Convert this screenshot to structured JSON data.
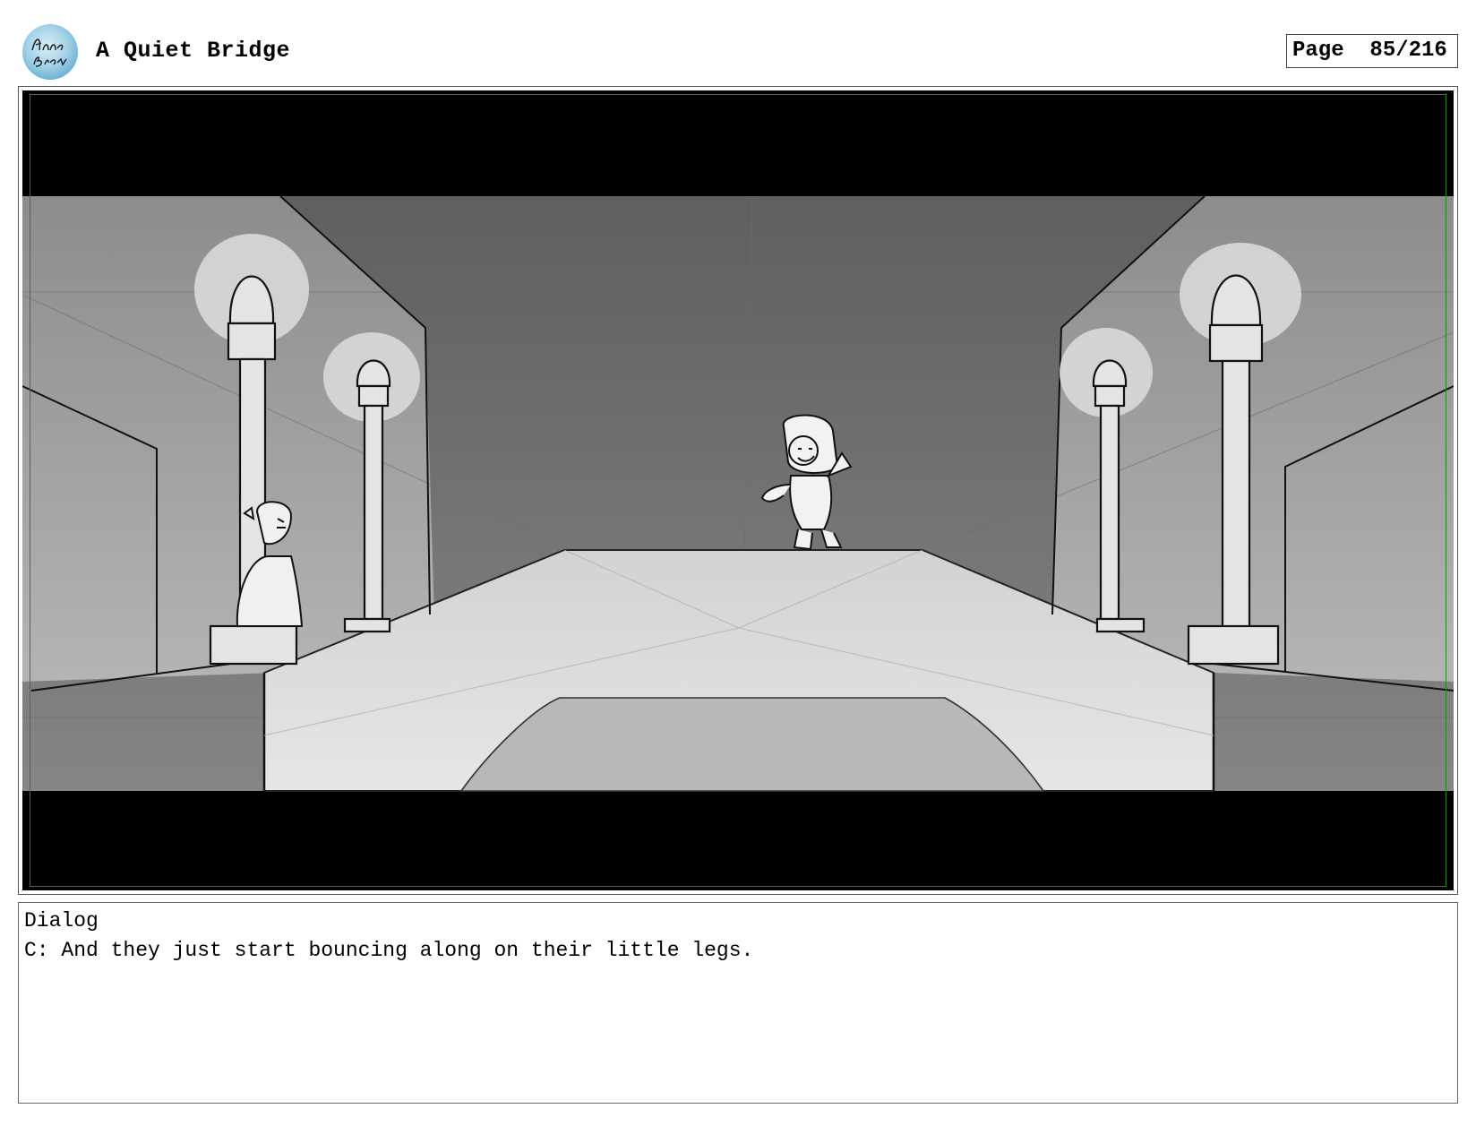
{
  "header": {
    "logo_signature": "Anna Brown",
    "title": "A Quiet Bridge",
    "page_label": "Page  85/216"
  },
  "panel": {
    "image_description": "Storyboard sketch of a bridge at night with four street lamps and two characters"
  },
  "dialog": {
    "heading": "Dialog",
    "text": "C: And they just start bouncing along on their little legs."
  },
  "colors": {
    "letterbox": "#000000",
    "safe_frame": "#1f8a1f",
    "logo_blue": "#8fc6e0"
  }
}
